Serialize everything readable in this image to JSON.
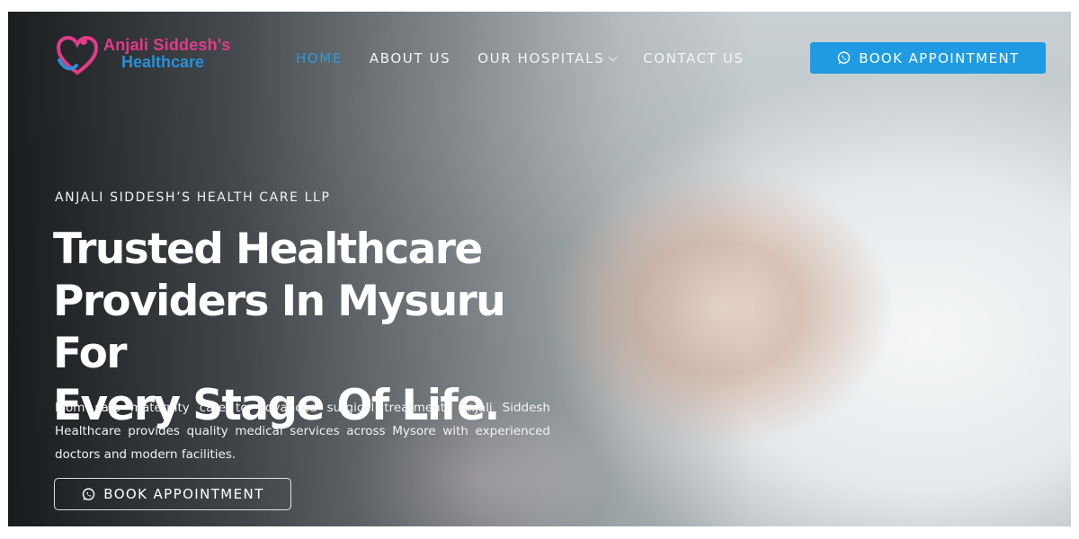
{
  "brand": {
    "name_line1": "Anjali Siddesh's",
    "name_line2": "Healthcare",
    "colors": {
      "pink": "#e23b8a",
      "blue": "#2a8fd6"
    }
  },
  "nav": {
    "items": [
      {
        "label": "HOME",
        "active": true
      },
      {
        "label": "ABOUT US",
        "active": false
      },
      {
        "label": "OUR HOSPITALS",
        "active": false,
        "has_dropdown": true
      },
      {
        "label": "CONTACT US",
        "active": false
      }
    ]
  },
  "header_cta": {
    "label": "BOOK APPOINTMENT",
    "icon": "whatsapp-icon",
    "color": "#1e9be2"
  },
  "hero": {
    "eyebrow": "ANJALI SIDDESH’S HEALTH CARE LLP",
    "headline_lines": [
      "Trusted Healthcare",
      "Providers In Mysuru For",
      "Every Stage Of Life."
    ],
    "description": "From safe maternity care to advanced surgical treatment, Anjali Siddesh Healthcare provides quality medical services across Mysore with experienced doctors and modern facilities.",
    "cta": {
      "label": "BOOK APPOINTMENT",
      "icon": "whatsapp-icon"
    }
  }
}
